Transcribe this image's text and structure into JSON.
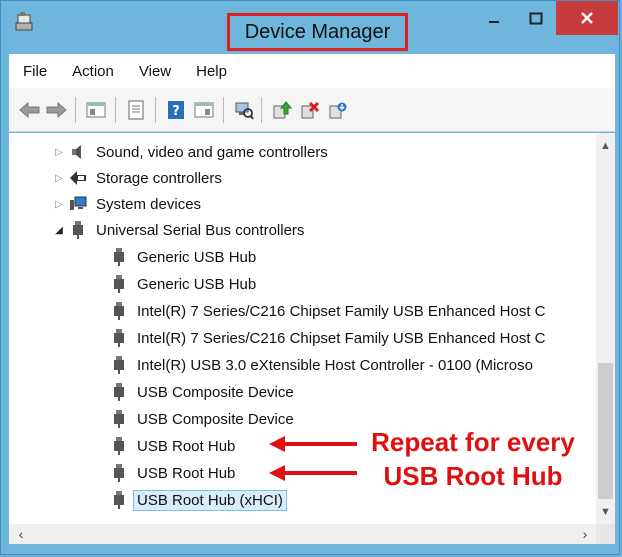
{
  "window": {
    "title": "Device Manager"
  },
  "colors": {
    "accent": "#e02020",
    "titlebar": "#6fb6dd",
    "close": "#c73b3b",
    "selection": "#d8ecf9"
  },
  "menu": [
    "File",
    "Action",
    "View",
    "Help"
  ],
  "toolbar_icons": [
    "back-icon",
    "forward-icon",
    "properties-window-icon",
    "properties-icon",
    "help-icon",
    "console-tree-icon",
    "scan-hardware-icon",
    "update-driver-icon",
    "disable-device-icon",
    "uninstall-device-icon"
  ],
  "tree": {
    "categories": [
      {
        "label": "Sound, video and game controllers",
        "icon": "speaker-icon",
        "expanded": false
      },
      {
        "label": "Storage controllers",
        "icon": "storage-icon",
        "expanded": false
      },
      {
        "label": "System devices",
        "icon": "computer-icon",
        "expanded": false
      },
      {
        "label": "Universal Serial Bus controllers",
        "icon": "usb-icon",
        "expanded": true
      }
    ],
    "usb_devices": [
      "Generic USB Hub",
      "Generic USB Hub",
      "Intel(R) 7 Series/C216 Chipset Family USB Enhanced Host C",
      "Intel(R) 7 Series/C216 Chipset Family USB Enhanced Host C",
      "Intel(R) USB 3.0 eXtensible Host Controller - 0100 (Microso",
      "USB Composite Device",
      "USB Composite Device",
      "USB Root Hub",
      "USB Root Hub",
      "USB Root Hub (xHCI)"
    ],
    "selected": "USB Root Hub (xHCI)"
  },
  "annotation": {
    "line1": "Repeat for every",
    "line2": "USB Root Hub"
  }
}
